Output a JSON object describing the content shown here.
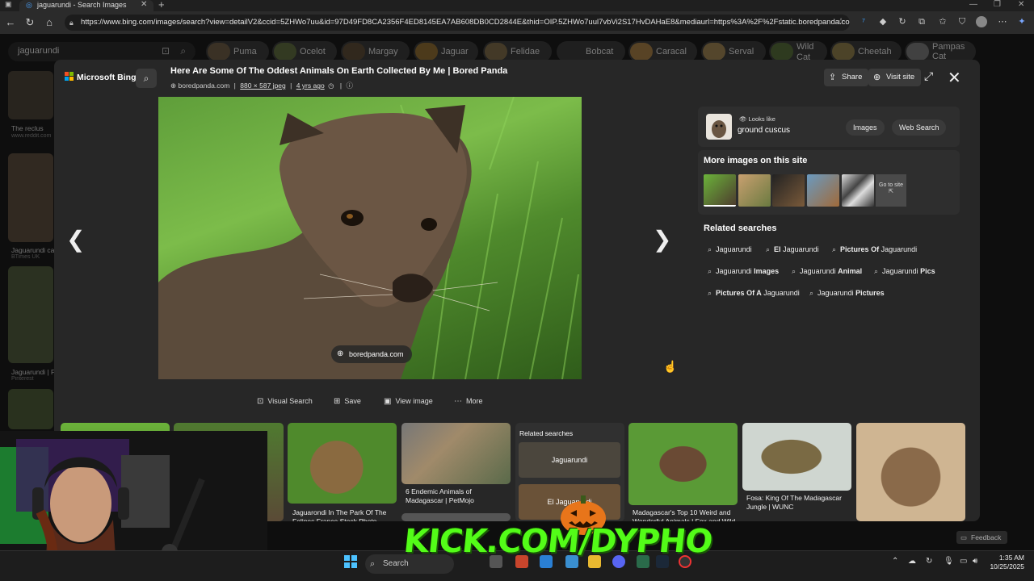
{
  "browser": {
    "tab_title": "jaguarundi - Search Images",
    "url": "https://www.bing.com/images/search?view=detailV2&ccid=5ZHWo7uu&id=97D49FD8CA2356F4ED8145EA7AB608DB0CD2844E&thid=OIP.5ZHWo7uul7vbVi2S17HvDAHaE8&mediaurl=https%3A%2F%2Fstatic.boredpanda.com..."
  },
  "bing": {
    "search_query": "jaguarundi",
    "chips": [
      "Puma",
      "Ocelot",
      "Margay",
      "Jaguar",
      "Felidae",
      "Bobcat",
      "Caracal",
      "Serval",
      "Wild Cat",
      "Cheetah",
      "Pampas Cat"
    ],
    "left_results": [
      {
        "caption": "The reclus",
        "source": "www.reddit.com"
      },
      {
        "caption": "Jaguarundi ca",
        "source": "BTimes UK"
      },
      {
        "caption": "Jaguarundi | F",
        "source": "Pinterest"
      }
    ]
  },
  "modal": {
    "brand": "Microsoft Bing",
    "title": "Here Are Some Of The Oddest Animals On Earth Collected By Me | Bored Panda",
    "meta_source": "boredpanda.com",
    "meta_size": "880 × 587 jpeg",
    "meta_age": "4 yrs ago",
    "share_label": "Share",
    "visit_label": "Visit site",
    "image_source_pill": "boredpanda.com",
    "actions": {
      "visual_search": "Visual Search",
      "save": "Save",
      "view_image": "View image",
      "more": "More"
    },
    "looks_like": {
      "label": "Looks like",
      "name": "ground cuscus",
      "images_btn": "Images",
      "web_btn": "Web Search"
    },
    "more_images_title": "More images on this site",
    "go_to_site": "Go to site",
    "related_title": "Related searches",
    "related": [
      {
        "pre": "",
        "bold": "",
        "post": "Jaguarundi"
      },
      {
        "pre": "",
        "bold": "El",
        "post": " Jaguarundi"
      },
      {
        "pre": "",
        "bold": "Pictures Of",
        "post": " Jaguarundi"
      },
      {
        "pre": "Jaguarundi ",
        "bold": "Images",
        "post": ""
      },
      {
        "pre": "Jaguarundi ",
        "bold": "Animal",
        "post": ""
      },
      {
        "pre": "Jaguarundi ",
        "bold": "Pics",
        "post": ""
      },
      {
        "pre": "",
        "bold": "Pictures Of A",
        "post": " Jaguarundi"
      },
      {
        "pre": "Jaguarundi ",
        "bold": "Pictures",
        "post": ""
      }
    ]
  },
  "bottom_strip": {
    "c1": "Jaguarondi In The Park Of The Felines France Stock Photo",
    "c2": "6 Endemic Animals of Madagascar | PetMojo",
    "related_title": "Related searches",
    "rel1": "Jaguarundi",
    "rel2": "El Jaguarundi",
    "c3": "Madagascar's Top 10 Weird and Wonderful Animals | Fox and Wild",
    "c4": "Fosa: King Of The Madagascar Jungle | WUNC"
  },
  "overlay": {
    "stream_logo": "KICK.COM/DYPHO"
  },
  "taskbar": {
    "search_label": "Search",
    "time": "1:35 AM",
    "date": "10/25/2025",
    "feedback": "Feedback"
  },
  "colors": {
    "kick_green": "#53fc18",
    "modal_bg": "#272727",
    "page_bg": "#1a1a1a"
  }
}
